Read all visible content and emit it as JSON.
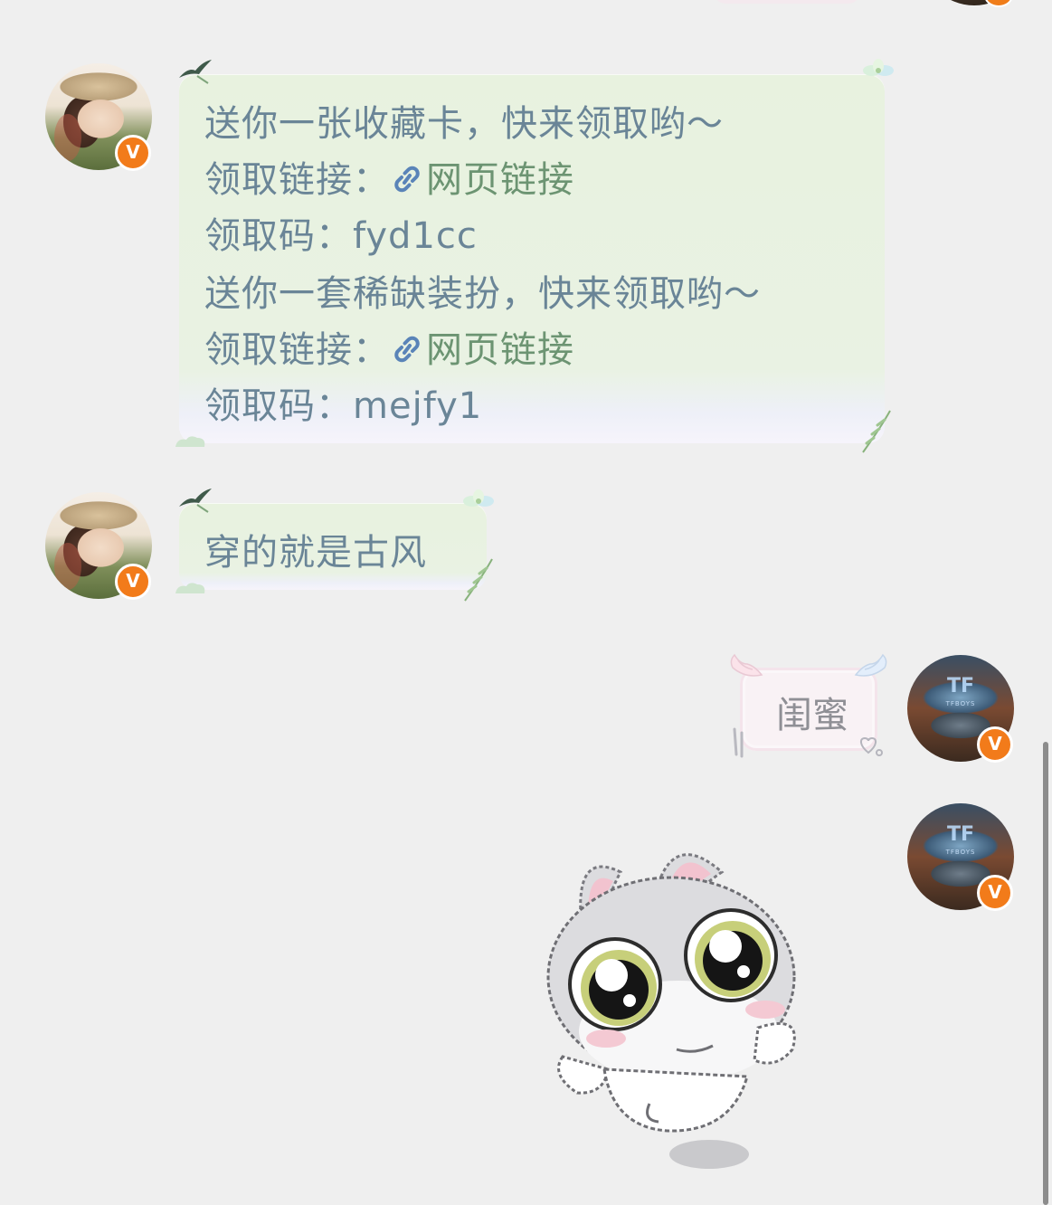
{
  "messages": [
    {
      "sender": "friend",
      "badge": "V",
      "lines": [
        {
          "text": "送你一张收藏卡，快来领取哟～"
        },
        {
          "label": "领取链接：",
          "link": "网页链接"
        },
        {
          "label": "领取码：",
          "value": "fyd1cc"
        },
        {
          "text": "送你一套稀缺装扮，快来领取哟～"
        },
        {
          "label": "领取链接：",
          "link": "网页链接"
        },
        {
          "label": "领取码：",
          "value": "mejfy1"
        }
      ]
    },
    {
      "sender": "friend",
      "badge": "V",
      "text": "穿的就是古风"
    },
    {
      "sender": "me",
      "badge": "V",
      "text": "闺蜜"
    },
    {
      "sender": "me",
      "badge": "V",
      "sticker": "crying-kitten-sticker"
    }
  ],
  "my_avatar": {
    "logo": "TF",
    "caption": "TFBOYS"
  },
  "colors": {
    "background": "#efefef",
    "bubble_text": "#6a8597",
    "link_text": "#6c9472",
    "badge": "#f27b1a",
    "pink_bubble_text": "#8f8f95"
  }
}
